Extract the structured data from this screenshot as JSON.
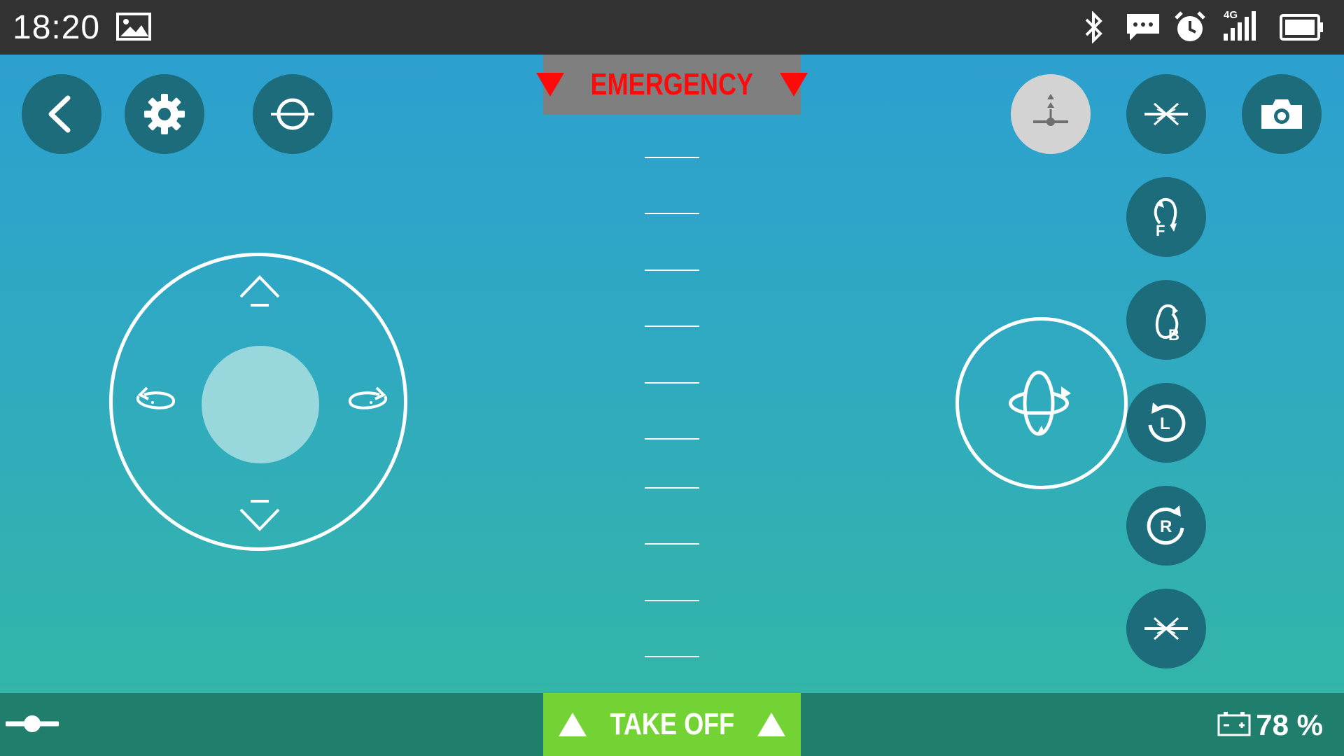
{
  "status_bar": {
    "time": "18:20",
    "icons": [
      "image-icon",
      "bluetooth-icon",
      "message-icon",
      "alarm-icon",
      "signal-4g-icon",
      "battery-icon"
    ],
    "network_label": "4G"
  },
  "controls": {
    "emergency_label": "EMERGENCY",
    "takeoff_label": "TAKE OFF",
    "battery_percent": "78 %"
  },
  "top_left_buttons": [
    "back-icon",
    "settings-icon",
    "calibrate-icon"
  ],
  "top_right_buttons": [
    "altitude-hold-icon",
    "headless-mode-icon",
    "camera-icon"
  ],
  "right_column_buttons": [
    "flip-forward-icon",
    "flip-back-icon",
    "flip-left-icon",
    "flip-right-icon",
    "one-key-return-icon"
  ],
  "right_column_letters": [
    "F",
    "B",
    "L",
    "R"
  ],
  "colors": {
    "accent_dark": "#1d6c7b",
    "emergency_red": "#ff0a0a",
    "takeoff_green": "#74d334",
    "bottom_bar": "#207e6d"
  }
}
